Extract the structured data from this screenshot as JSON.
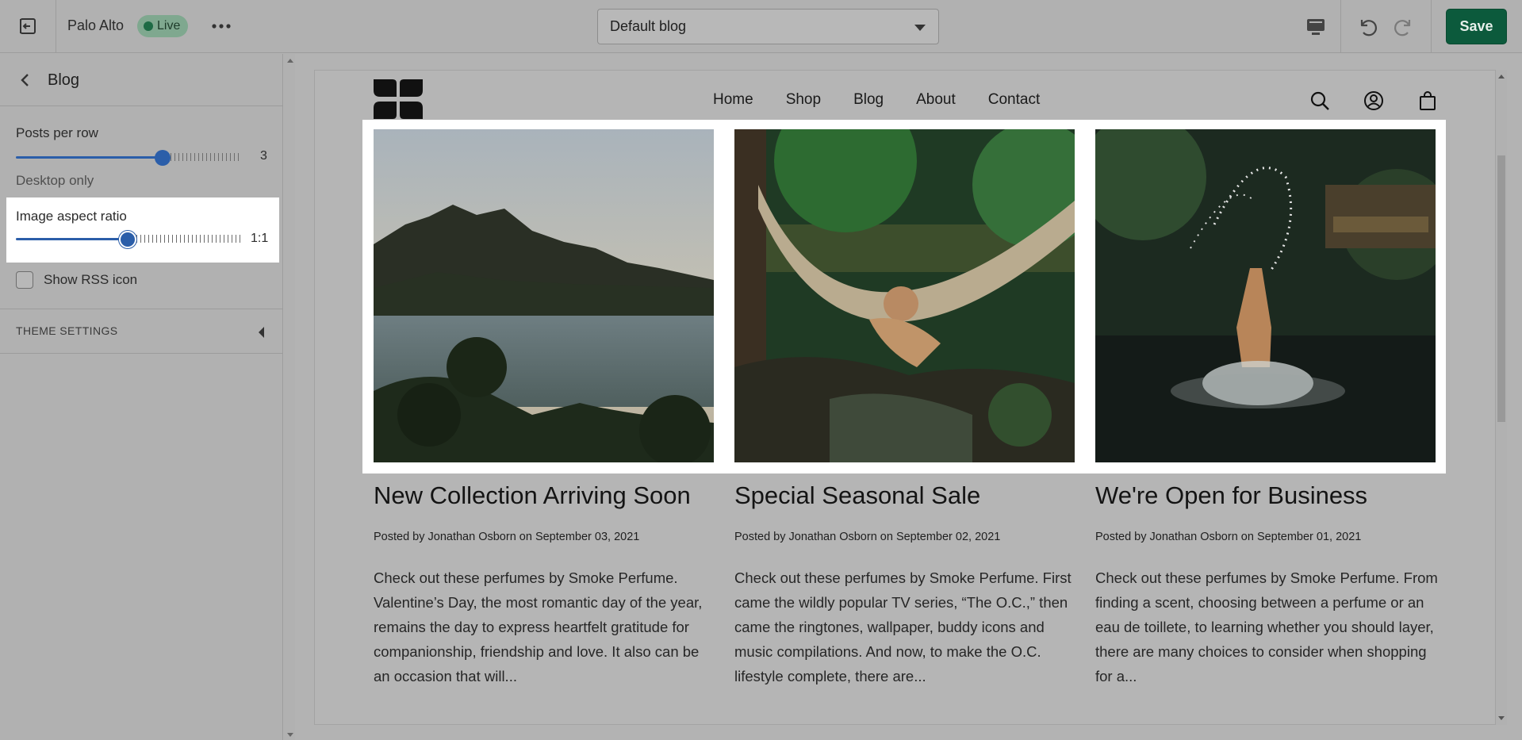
{
  "topbar": {
    "theme_name": "Palo Alto",
    "live_label": "Live",
    "template_select": "Default blog",
    "save_label": "Save"
  },
  "sidebar": {
    "title": "Blog",
    "posts_per_row": {
      "label": "Posts per row",
      "value": "3",
      "fraction": 0.66
    },
    "hint": "Desktop only",
    "image_aspect_ratio": {
      "label": "Image aspect ratio",
      "value": "1:1",
      "fraction": 0.51
    },
    "show_rss": {
      "label": "Show RSS icon",
      "checked": false
    },
    "theme_settings": "THEME SETTINGS"
  },
  "store": {
    "nav": [
      "Home",
      "Shop",
      "Blog",
      "About",
      "Contact"
    ],
    "posts": [
      {
        "title": "New Collection Arriving Soon",
        "meta": "Posted by Jonathan Osborn on September 03, 2021",
        "excerpt": "Check out these perfumes by Smoke Perfume. Valentine’s Day, the most romantic day of the year, remains the day to express heartfelt gratitude for companionship, friendship and love. It also can be an occasion that will..."
      },
      {
        "title": "Special Seasonal Sale",
        "meta": "Posted by Jonathan Osborn on September 02, 2021",
        "excerpt": "Check out these perfumes by Smoke Perfume. First came the wildly popular TV series, “The O.C.,” then came the ringtones, wallpaper, buddy icons and music compilations.  And now, to make the O.C. lifestyle complete, there are..."
      },
      {
        "title": "We're Open for Business",
        "meta": "Posted by Jonathan Osborn on September 01, 2021",
        "excerpt": "Check out these perfumes by Smoke Perfume. From finding a scent, choosing between a perfume or an eau de toillete, to learning whether you should layer, there are many choices to consider when shopping for a..."
      }
    ]
  },
  "colors": {
    "accent": "#2b5ea9",
    "save": "#0c5a3c",
    "live_badge": "#7fa88f"
  }
}
